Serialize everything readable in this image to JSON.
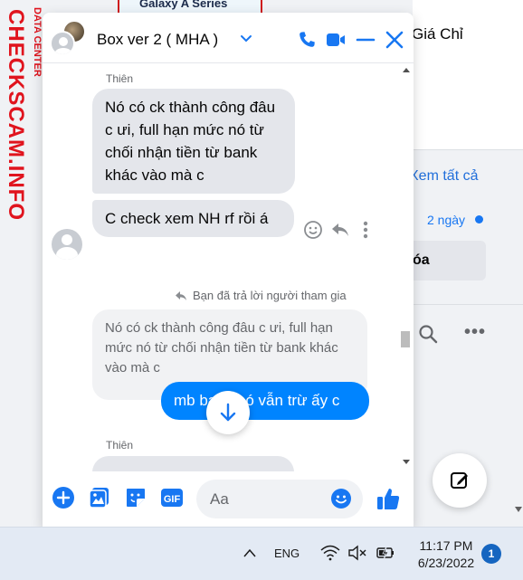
{
  "background": {
    "side_title": "Giá Chỉ",
    "see_all": "Xem tất cả",
    "time_ago": "2 ngày",
    "button_fragment": "óa",
    "more": "•••",
    "watermark_main": "CHECKSCAM.INFO",
    "watermark_sub": "DATA CENTER",
    "banner_text": "Galaxy A Series"
  },
  "chat": {
    "title": "Box ver 2 ( MHA )",
    "icons": [
      "phone-icon",
      "video-icon",
      "minimize-icon",
      "close-icon"
    ],
    "accent": "#0084ff",
    "messages": [
      {
        "sender": "Thiên",
        "text": "Nó có ck thành công đâu c ưi, full hạn mức nó từ chối nhận tiền từ bank khác vào mà c"
      },
      {
        "text": "C check xem NH rf rồi á"
      }
    ],
    "reply_note": "Bạn đã trả lời người tham gia",
    "quoted": "Nó có ck thành công đâu c ưi, full hạn mức nó từ chối nhận tiền từ bank khác vào mà c",
    "my_message": "mb bank nó vẫn trừ ấy c",
    "next_sender": "Thiên",
    "composer_placeholder": "Aa"
  },
  "taskbar": {
    "language": "ENG",
    "time": "11:17 PM",
    "date": "6/23/2022",
    "notifications": "1"
  }
}
